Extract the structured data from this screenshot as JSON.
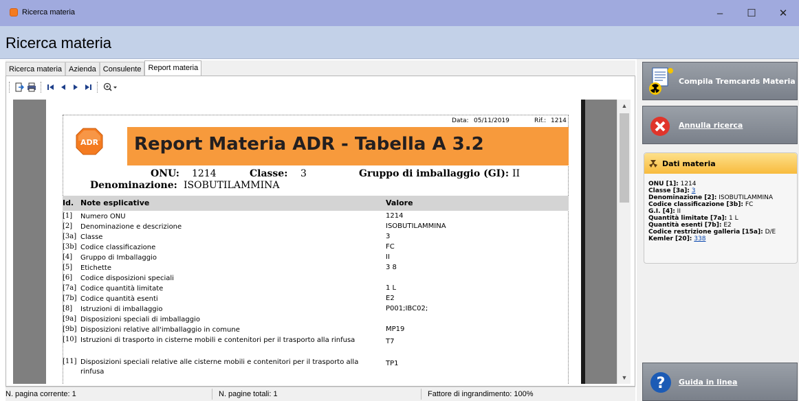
{
  "window": {
    "title": "Ricerca materia"
  },
  "header": {
    "title": "Ricerca materia"
  },
  "tabs": [
    {
      "label": "Ricerca materia"
    },
    {
      "label": "Azienda"
    },
    {
      "label": "Consulente"
    },
    {
      "label": "Report materia"
    }
  ],
  "report": {
    "date_label": "Data:",
    "date": "05/11/2019",
    "ref_label": "Rif.:",
    "ref": "1214",
    "logo_text": "ADR",
    "title": "Report Materia ADR - Tabella A 3.2",
    "onu_label": "ONU:",
    "onu": "1214",
    "classe_label": "Classe:",
    "classe": "3",
    "gruppo_label": "Gruppo di imballaggio (GI):",
    "gruppo": "II",
    "denominazione_label": "Denominazione:",
    "denominazione": "ISOBUTILAMMINA",
    "columns": [
      "Id.",
      "Note esplicative",
      "Valore"
    ],
    "rows": [
      {
        "id": "[1]",
        "note": "Numero ONU",
        "value": "1214"
      },
      {
        "id": "[2]",
        "note": "Denominazione e descrizione",
        "value": "ISOBUTILAMMINA"
      },
      {
        "id": "[3a]",
        "note": "Classe",
        "value": "3"
      },
      {
        "id": "[3b]",
        "note": "Codice classificazione",
        "value": "FC"
      },
      {
        "id": "[4]",
        "note": "Gruppo di Imballaggio",
        "value": "II"
      },
      {
        "id": "[5]",
        "note": "Etichette",
        "value": "3 8"
      },
      {
        "id": "[6]",
        "note": "Codice disposizioni speciali",
        "value": ""
      },
      {
        "id": "[7a]",
        "note": "Codice quantità limitate",
        "value": "1 L"
      },
      {
        "id": "[7b]",
        "note": "Codice quantità esenti",
        "value": "E2"
      },
      {
        "id": "[8]",
        "note": "Istruzioni di imballaggio",
        "value": "P001;IBC02;"
      },
      {
        "id": "[9a]",
        "note": "Disposizioni speciali di imballaggio",
        "value": ""
      },
      {
        "id": "[9b]",
        "note": "Disposizioni relative all'imballaggio in comune",
        "value": "MP19"
      },
      {
        "id": "[10]",
        "note": "Istruzioni di trasporto in cisterne mobili e contenitori per il trasporto alla rinfusa",
        "value": "T7"
      },
      {
        "id": "[11]",
        "note": "Disposizioni speciali relative alle cisterne mobili e contenitori per il trasporto alla rinfusa",
        "value": "TP1"
      }
    ]
  },
  "status": {
    "current_page": "N. pagina corrente: 1",
    "total_pages": "N. pagine totali: 1",
    "zoom": "Fattore di ingrandimento: 100%"
  },
  "actions": {
    "compila": "Compila Tremcards Materia",
    "annulla": "Annulla ricerca",
    "guida": "Guida in linea"
  },
  "dati": {
    "title": "Dati materia",
    "onu_label": "ONU [1]:",
    "onu": "1214",
    "classe_label": "Classe [3a]:",
    "classe": "3",
    "denominazione_label": "Denominazione [2]:",
    "denominazione": "ISOBUTILAMMINA",
    "codice_label": "Codice classificazione [3b]:",
    "codice": "FC",
    "gi_label": "G.I. [4]:",
    "gi": "II",
    "qlim_label": "Quantità limitate [7a]:",
    "qlim": "1 L",
    "qes_label": "Quantità esenti [7b]:",
    "qes": "E2",
    "galleria_label": "Codice restrizione galleria [15a]:",
    "galleria": "D/E",
    "kemler_label": "Kemler [20]:",
    "kemler": "338"
  },
  "colors": {
    "accent": "#f79a3c",
    "header": "#c3d1e8",
    "titlebar": "#a0aade"
  }
}
